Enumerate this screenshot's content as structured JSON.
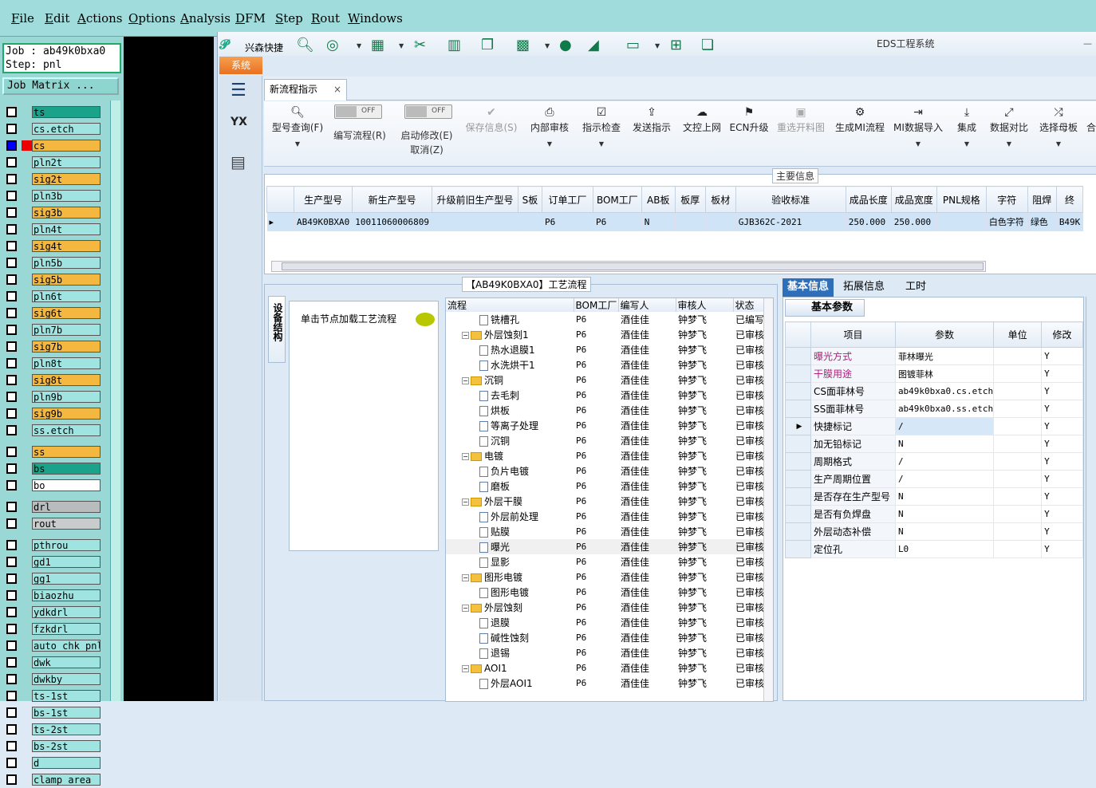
{
  "cam_menu": [
    "File",
    "Edit",
    "Actions",
    "Options",
    "Analysis",
    "DFM",
    "Step",
    "Rout",
    "Windows"
  ],
  "job": {
    "job_line": "Job : ab49k0bxa0",
    "step_line": "Step: pnl",
    "matrix_label": "Job Matrix ..."
  },
  "layers": [
    {
      "name": "ts",
      "color": "#1aa38a"
    },
    {
      "name": "cs.etch",
      "color": "#9fe4e0"
    },
    {
      "name": "cs",
      "color": "#f4b840",
      "active": true
    },
    {
      "name": "pln2t",
      "color": "#9fe4e0"
    },
    {
      "name": "sig2t",
      "color": "#f4b840"
    },
    {
      "name": "pln3b",
      "color": "#9fe4e0"
    },
    {
      "name": "sig3b",
      "color": "#f4b840"
    },
    {
      "name": "pln4t",
      "color": "#9fe4e0"
    },
    {
      "name": "sig4t",
      "color": "#f4b840"
    },
    {
      "name": "pln5b",
      "color": "#9fe4e0"
    },
    {
      "name": "sig5b",
      "color": "#f4b840"
    },
    {
      "name": "pln6t",
      "color": "#9fe4e0"
    },
    {
      "name": "sig6t",
      "color": "#f4b840"
    },
    {
      "name": "pln7b",
      "color": "#9fe4e0"
    },
    {
      "name": "sig7b",
      "color": "#f4b840"
    },
    {
      "name": "pln8t",
      "color": "#9fe4e0"
    },
    {
      "name": "sig8t",
      "color": "#f4b840"
    },
    {
      "name": "pln9b",
      "color": "#9fe4e0"
    },
    {
      "name": "sig9b",
      "color": "#f4b840"
    },
    {
      "name": "ss.etch",
      "color": "#9fe4e0"
    },
    {
      "name": "ss",
      "color": "#f4b840"
    },
    {
      "name": "bs",
      "color": "#1aa38a"
    },
    {
      "name": "bo",
      "color": "#ffffff"
    },
    {
      "name": "drl",
      "color": "#b8bcbc"
    },
    {
      "name": "rout",
      "color": "#c8cccc"
    },
    {
      "name": "pthrou",
      "color": "#9fe4e0"
    },
    {
      "name": "gd1",
      "color": "#9fe4e0"
    },
    {
      "name": "gg1",
      "color": "#9fe4e0"
    },
    {
      "name": "biaozhu",
      "color": "#9fe4e0"
    },
    {
      "name": "ydkdrl",
      "color": "#9fe4e0"
    },
    {
      "name": "fzkdrl",
      "color": "#9fe4e0"
    },
    {
      "name": "auto_chk_pnl",
      "color": "#9fe4e0"
    },
    {
      "name": "dwk",
      "color": "#9fe4e0"
    },
    {
      "name": "dwkby",
      "color": "#9fe4e0"
    },
    {
      "name": "ts-1st",
      "color": "#9fe4e0"
    },
    {
      "name": "bs-1st",
      "color": "#9fe4e0"
    },
    {
      "name": "ts-2st",
      "color": "#9fe4e0"
    },
    {
      "name": "bs-2st",
      "color": "#9fe4e0"
    },
    {
      "name": "d",
      "color": "#9fe4e0"
    },
    {
      "name": "clamp_area",
      "color": "#9fe4e0"
    }
  ],
  "eds": {
    "title": "EDS工程系统",
    "brand": "兴森快捷",
    "sys_tab": "系统",
    "tab_label": "新流程指示",
    "tab_close": "×",
    "ribbon": {
      "query": "型号查询(F)",
      "edit_flow": "编写流程(R)",
      "auto_modify": "启动修改(E)",
      "cancel": "取消(Z)",
      "toggle_off": "OFF",
      "buttons": [
        "保存信息(S)",
        "内部审核",
        "指示检查",
        "发送指示",
        "文控上网",
        "ECN升级",
        "重选开料图",
        "生成MI流程",
        "MI数据导入",
        "集成",
        "数据对比",
        "选择母板",
        "合"
      ]
    },
    "main_info": {
      "title": "主要信息",
      "columns": [
        "生产型号",
        "新生产型号",
        "升级前旧生产型号",
        "S板",
        "订单工厂",
        "BOM工厂",
        "AB板",
        "板厚",
        "板材",
        "验收标准",
        "成品长度",
        "成品宽度",
        "PNL规格",
        "字符",
        "阻焊",
        "终"
      ],
      "row": [
        "AB49K0BXA0",
        "10011060006809",
        "",
        "",
        "P6",
        "P6",
        "N",
        "",
        "",
        "GJB362C-2021",
        "250.000",
        "250.000",
        "",
        "白色字符",
        "绿色",
        "B49K"
      ]
    },
    "process": {
      "title": "【AB49K0BXA0】工艺流程",
      "vtab": "设备结构",
      "hint": "单击节点加载工艺流程",
      "columns": [
        "流程",
        "BOM工厂",
        "编写人",
        "审核人",
        "状态"
      ],
      "rows": [
        {
          "name": "铣槽孔",
          "lvl": 2,
          "bom": "P6",
          "writer": "酒佳佳",
          "reviewer": "钟梦飞",
          "status": "已编写"
        },
        {
          "name": "外层蚀刻1",
          "lvl": 1,
          "bom": "P6",
          "writer": "酒佳佳",
          "reviewer": "钟梦飞",
          "status": "已审核"
        },
        {
          "name": "热水退膜1",
          "lvl": 2,
          "bom": "P6",
          "writer": "酒佳佳",
          "reviewer": "钟梦飞",
          "status": "已审核"
        },
        {
          "name": "水洗烘干1",
          "lvl": 2,
          "bom": "P6",
          "writer": "酒佳佳",
          "reviewer": "钟梦飞",
          "status": "已审核"
        },
        {
          "name": "沉铜",
          "lvl": 1,
          "bom": "P6",
          "writer": "酒佳佳",
          "reviewer": "钟梦飞",
          "status": "已审核"
        },
        {
          "name": "去毛刺",
          "lvl": 2,
          "bom": "P6",
          "writer": "酒佳佳",
          "reviewer": "钟梦飞",
          "status": "已审核"
        },
        {
          "name": "烘板",
          "lvl": 2,
          "bom": "P6",
          "writer": "酒佳佳",
          "reviewer": "钟梦飞",
          "status": "已审核"
        },
        {
          "name": "等离子处理",
          "lvl": 2,
          "bom": "P6",
          "writer": "酒佳佳",
          "reviewer": "钟梦飞",
          "status": "已审核"
        },
        {
          "name": "沉铜",
          "lvl": 2,
          "bom": "P6",
          "writer": "酒佳佳",
          "reviewer": "钟梦飞",
          "status": "已审核"
        },
        {
          "name": "电镀",
          "lvl": 1,
          "bom": "P6",
          "writer": "酒佳佳",
          "reviewer": "钟梦飞",
          "status": "已审核"
        },
        {
          "name": "负片电镀",
          "lvl": 2,
          "bom": "P6",
          "writer": "酒佳佳",
          "reviewer": "钟梦飞",
          "status": "已审核"
        },
        {
          "name": "磨板",
          "lvl": 2,
          "bom": "P6",
          "writer": "酒佳佳",
          "reviewer": "钟梦飞",
          "status": "已审核"
        },
        {
          "name": "外层干膜",
          "lvl": 1,
          "bom": "P6",
          "writer": "酒佳佳",
          "reviewer": "钟梦飞",
          "status": "已审核"
        },
        {
          "name": "外层前处理",
          "lvl": 2,
          "bom": "P6",
          "writer": "酒佳佳",
          "reviewer": "钟梦飞",
          "status": "已审核"
        },
        {
          "name": "贴膜",
          "lvl": 2,
          "bom": "P6",
          "writer": "酒佳佳",
          "reviewer": "钟梦飞",
          "status": "已审核"
        },
        {
          "name": "曝光",
          "lvl": 2,
          "bom": "P6",
          "writer": "酒佳佳",
          "reviewer": "钟梦飞",
          "status": "已审核",
          "selected": true
        },
        {
          "name": "显影",
          "lvl": 2,
          "bom": "P6",
          "writer": "酒佳佳",
          "reviewer": "钟梦飞",
          "status": "已审核"
        },
        {
          "name": "图形电镀",
          "lvl": 1,
          "bom": "P6",
          "writer": "酒佳佳",
          "reviewer": "钟梦飞",
          "status": "已审核"
        },
        {
          "name": "图形电镀",
          "lvl": 2,
          "bom": "P6",
          "writer": "酒佳佳",
          "reviewer": "钟梦飞",
          "status": "已审核"
        },
        {
          "name": "外层蚀刻",
          "lvl": 1,
          "bom": "P6",
          "writer": "酒佳佳",
          "reviewer": "钟梦飞",
          "status": "已审核"
        },
        {
          "name": "退膜",
          "lvl": 2,
          "bom": "P6",
          "writer": "酒佳佳",
          "reviewer": "钟梦飞",
          "status": "已审核"
        },
        {
          "name": "碱性蚀刻",
          "lvl": 2,
          "bom": "P6",
          "writer": "酒佳佳",
          "reviewer": "钟梦飞",
          "status": "已审核"
        },
        {
          "name": "退锡",
          "lvl": 2,
          "bom": "P6",
          "writer": "酒佳佳",
          "reviewer": "钟梦飞",
          "status": "已审核"
        },
        {
          "name": "AOI1",
          "lvl": 1,
          "bom": "P6",
          "writer": "酒佳佳",
          "reviewer": "钟梦飞",
          "status": "已审核"
        },
        {
          "name": "外层AOI1",
          "lvl": 2,
          "bom": "P6",
          "writer": "酒佳佳",
          "reviewer": "钟梦飞",
          "status": "已审核"
        }
      ]
    },
    "basic": {
      "tabs": [
        "基本信息",
        "拓展信息",
        "工时"
      ],
      "sub_title": "基本参数",
      "columns": [
        "项目",
        "参数",
        "单位",
        "修改"
      ],
      "rows": [
        {
          "item": "曝光方式",
          "param": "菲林曝光",
          "unit": "",
          "mod": "Y",
          "pink": true
        },
        {
          "item": "干膜用途",
          "param": "图镀菲林",
          "unit": "",
          "mod": "Y",
          "pink": true
        },
        {
          "item": "CS面菲林号",
          "param": "ab49k0bxa0.cs.etch",
          "unit": "",
          "mod": "Y"
        },
        {
          "item": "SS面菲林号",
          "param": "ab49k0bxa0.ss.etch",
          "unit": "",
          "mod": "Y"
        },
        {
          "item": "快捷标记",
          "param": "/",
          "unit": "",
          "mod": "Y",
          "current": true
        },
        {
          "item": "加无铅标记",
          "param": "N",
          "unit": "",
          "mod": "Y"
        },
        {
          "item": "周期格式",
          "param": "/",
          "unit": "",
          "mod": "Y"
        },
        {
          "item": "生产周期位置",
          "param": "/",
          "unit": "",
          "mod": "Y"
        },
        {
          "item": "是否存在生产型号",
          "param": "N",
          "unit": "",
          "mod": "Y"
        },
        {
          "item": "是否有负焊盘",
          "param": "N",
          "unit": "",
          "mod": "Y"
        },
        {
          "item": "外层动态补偿",
          "param": "N",
          "unit": "",
          "mod": "Y"
        },
        {
          "item": "定位孔",
          "param": "L0",
          "unit": "",
          "mod": "Y"
        }
      ]
    }
  }
}
